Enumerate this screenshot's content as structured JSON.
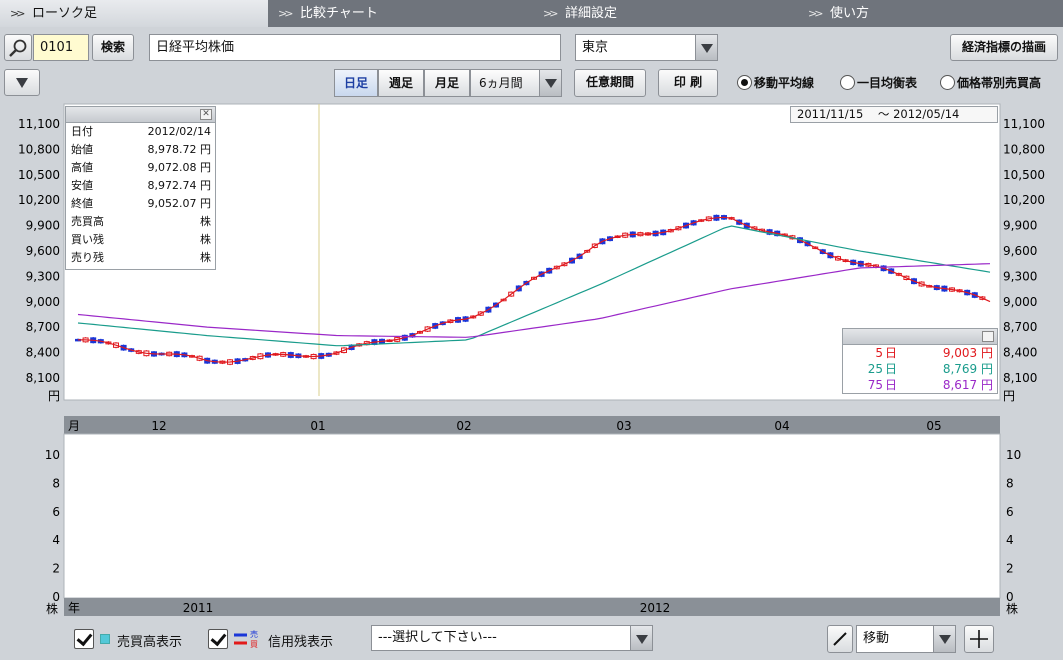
{
  "tabs": [
    {
      "label": "ローソク足",
      "active": true
    },
    {
      "label": "比較チャート",
      "active": false
    },
    {
      "label": "詳細設定",
      "active": false
    },
    {
      "label": "使い方",
      "active": false
    }
  ],
  "toolbar": {
    "code_value": "0101",
    "search_label": "検索",
    "stock_name": "日経平均株価",
    "market": "東京",
    "economic_btn": "経済指標の描画",
    "periods": [
      "日足",
      "週足",
      "月足"
    ],
    "active_period": "日足",
    "span": "6ヵ月間",
    "custom_period": "任意期間",
    "print": "印 刷",
    "overlays": [
      {
        "label": "移動平均線",
        "selected": true
      },
      {
        "label": "一目均衡表",
        "selected": false
      },
      {
        "label": "価格帯別売買高",
        "selected": false
      }
    ]
  },
  "range": {
    "from": "2011/11/15",
    "sep": "〜",
    "to": "2012/05/14"
  },
  "info": {
    "rows": [
      {
        "k": "日付",
        "v": "2012/02/14"
      },
      {
        "k": "始値",
        "v": "8,978.72 円"
      },
      {
        "k": "高値",
        "v": "9,072.08 円"
      },
      {
        "k": "安値",
        "v": "8,972.74 円"
      },
      {
        "k": "終値",
        "v": "9,052.07 円"
      },
      {
        "k": "売買高",
        "v": "株"
      },
      {
        "k": "買い残",
        "v": "株"
      },
      {
        "k": "売り残",
        "v": "株"
      }
    ]
  },
  "ma": [
    {
      "n": "5",
      "unit": "日",
      "val": "9,003 円",
      "color": "#e0191e"
    },
    {
      "n": "25",
      "unit": "日",
      "val": "8,769 円",
      "color": "#1a9c8c"
    },
    {
      "n": "75",
      "unit": "日",
      "val": "8,617 円",
      "color": "#9a28c8"
    }
  ],
  "axis": {
    "price_ticks": [
      "11,100",
      "10,800",
      "10,500",
      "10,200",
      "9,900",
      "9,600",
      "9,300",
      "9,000",
      "8,700",
      "8,400",
      "8,100"
    ],
    "price_unit": "円",
    "month_label": "月",
    "months": [
      "12",
      "01",
      "02",
      "03",
      "04",
      "05"
    ],
    "vol_ticks": [
      "10",
      "8",
      "6",
      "4",
      "2",
      "0"
    ],
    "vol_unit": "株",
    "year_label": "年",
    "years": [
      "2011",
      "2012"
    ]
  },
  "chart_data": {
    "type": "line",
    "title": "",
    "ylim": [
      8100,
      11100
    ],
    "x": [
      "2011-11-15",
      "2011-12-01",
      "2012-01-04",
      "2012-02-01",
      "2012-03-01",
      "2012-04-02",
      "2012-05-01",
      "2012-05-14"
    ],
    "series": [
      {
        "name": "5日",
        "values": [
          8550,
          8300,
          8400,
          8800,
          9700,
          10000,
          9450,
          9003
        ]
      },
      {
        "name": "25日",
        "values": [
          8750,
          8600,
          8480,
          8550,
          9200,
          9900,
          9600,
          9350
        ]
      },
      {
        "name": "75日",
        "values": [
          8850,
          8700,
          8600,
          8580,
          8800,
          9150,
          9400,
          9450
        ]
      }
    ]
  },
  "bottom": {
    "volume_label": "売買高表示",
    "margin_label": "信用残表示",
    "select_placeholder": "---選択して下さい---",
    "tool": "移動"
  }
}
